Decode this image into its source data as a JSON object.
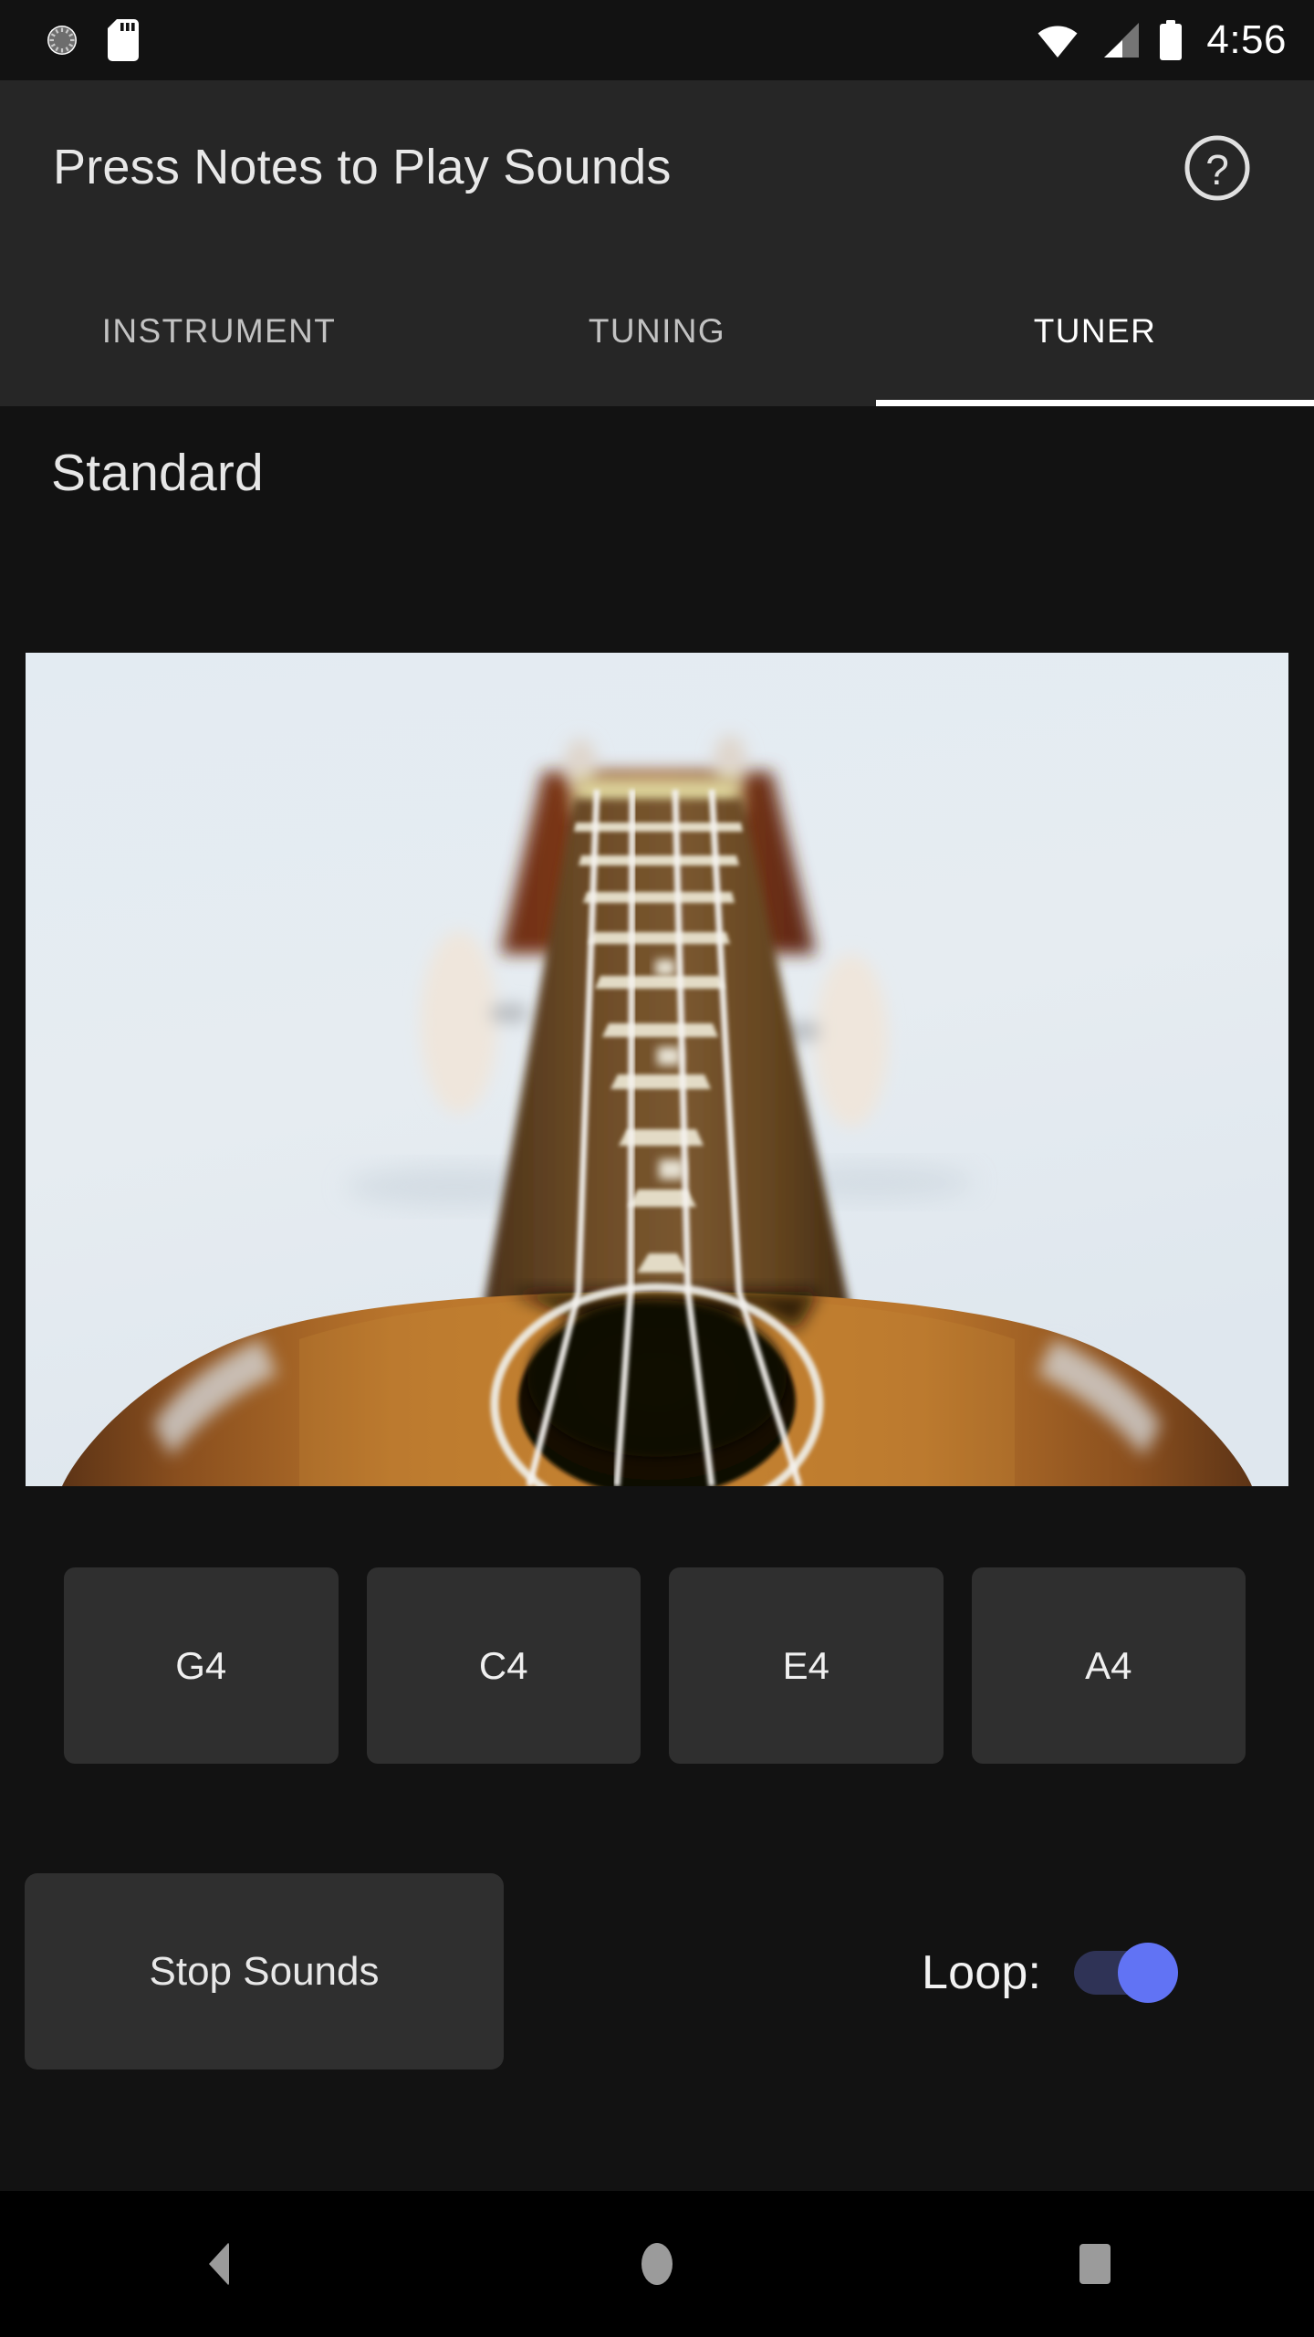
{
  "status_bar": {
    "icons_left": [
      "sync-icon",
      "sd-card-icon"
    ],
    "icons_right": [
      "wifi-icon",
      "cell-signal-icon",
      "battery-icon"
    ],
    "time": "4:56"
  },
  "app_bar": {
    "title": "Press Notes to Play Sounds",
    "help_icon": "help-circle-icon"
  },
  "tabs": [
    {
      "label": "INSTRUMENT",
      "active": false
    },
    {
      "label": "TUNING",
      "active": false
    },
    {
      "label": "TUNER",
      "active": true
    }
  ],
  "content": {
    "tuning_name": "Standard",
    "instrument_image": "ukulele-photo",
    "notes": [
      {
        "label": "G4"
      },
      {
        "label": "C4"
      },
      {
        "label": "E4"
      },
      {
        "label": "A4"
      }
    ],
    "stop_button": "Stop Sounds",
    "loop": {
      "label": "Loop:",
      "state": "on"
    }
  },
  "nav_bar": {
    "back": "back-icon",
    "home": "home-icon",
    "recents": "recents-icon"
  },
  "colors": {
    "app_bar_bg": "#262626",
    "body_bg": "#121212",
    "button_bg": "#2f2f2f",
    "accent": "#6173f4",
    "switch_track": "#2f3356",
    "tab_active": "#ffffff",
    "tab_inactive": "#c2c2c2",
    "nav_bar_bg": "#000000"
  }
}
